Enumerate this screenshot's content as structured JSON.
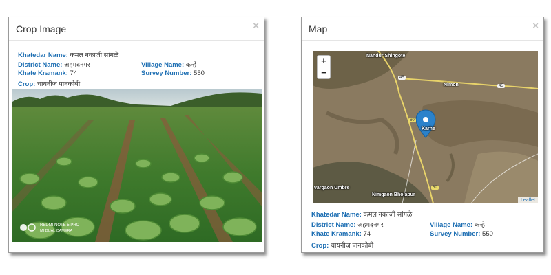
{
  "crop_modal": {
    "title": "Crop Image",
    "close": "×",
    "khatedar_label": "Khatedar Name:",
    "khatedar_value": "कमल नकाजी सांगळे",
    "district_label": "District Name:",
    "district_value": "अहमदनगर",
    "village_label": "Village Name:",
    "village_value": "कन्हे",
    "khate_label": "Khate Kramank:",
    "khate_value": "74",
    "survey_label": "Survey Number:",
    "survey_value": "550",
    "crop_label": "Crop:",
    "crop_value": "चायनीज पानकोबी",
    "watermark_line1": "REDMI NOTE 5 PRO",
    "watermark_line2": "MI DUAL CAMERA"
  },
  "map_modal": {
    "title": "Map",
    "close": "×",
    "zoom_in": "+",
    "zoom_out": "−",
    "attribution": "Leaflet",
    "place_labels": {
      "nandur": "Nandur Shingote",
      "nimon": "Nimon",
      "karhe": "Karhe",
      "vargaon": "vargaon Umbre",
      "nimgaon": "Nimgaon Bhojapur"
    },
    "road_shields": [
      "45",
      "45",
      "60",
      "60"
    ],
    "khatedar_label": "Khatedar Name:",
    "khatedar_value": "कमल नकाजी सांगळे",
    "district_label": "District Name:",
    "district_value": "अहमदनगर",
    "village_label": "Village Name:",
    "village_value": "कन्हे",
    "khate_label": "Khate Kramank:",
    "khate_value": "74",
    "survey_label": "Survey Number:",
    "survey_value": "550",
    "crop_label": "Crop:",
    "crop_value": "चायनीज पानकोबी"
  }
}
